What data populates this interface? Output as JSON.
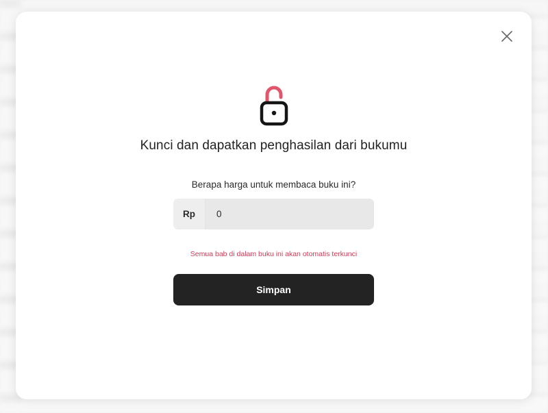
{
  "modal": {
    "close_icon": "close-icon",
    "lock_icon": "unlocked-padlock-icon",
    "title": "Kunci dan dapatkan penghasilan dari bukumu",
    "question": "Berapa harga untuk membaca buku ini?",
    "price": {
      "prefix": "Rp",
      "value": "0"
    },
    "warning": "Semua bab di dalam buku ini akan otomatis terkunci",
    "save_label": "Simpan"
  },
  "colors": {
    "accent_red": "#d23a55",
    "lock_shackle": "#e0566b",
    "button_bg": "#232323",
    "field_bg": "#e9e9e9"
  }
}
